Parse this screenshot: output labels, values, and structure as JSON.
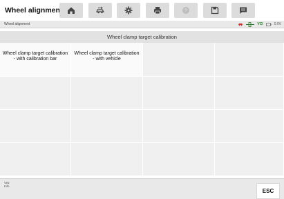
{
  "app": {
    "title": "Wheel alignment"
  },
  "toolbar": {
    "buttons": [
      {
        "icon": "home-icon"
      },
      {
        "icon": "vehicle-swap-icon"
      },
      {
        "icon": "gear-icon"
      },
      {
        "icon": "printer-icon"
      },
      {
        "icon": "help-icon"
      },
      {
        "icon": "save-icon"
      },
      {
        "icon": "message-icon"
      }
    ]
  },
  "status": {
    "breadcrumb": "Wheel alignment",
    "vci_label": "VCI",
    "voltage": "0.0V"
  },
  "section": {
    "header": "Wheel clamp target calibration"
  },
  "options": [
    {
      "label": "Wheel clamp target calibration - with calibration bar"
    },
    {
      "label": "Wheel clamp target calibration - with vehicle"
    }
  ],
  "footer": {
    "vin_label": "VIN",
    "info_label": "Info",
    "esc_label": "ESC"
  },
  "colors": {
    "toolbar_button": "#dcdcdc",
    "header_bg": "#e2e2e2",
    "grid_bg": "#f0f0f0",
    "accent_red": "#d32f2f",
    "accent_green": "#2b7a2b"
  }
}
